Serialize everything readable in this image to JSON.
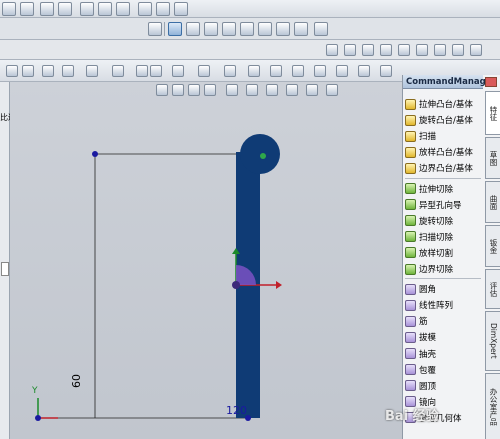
{
  "command_manager": {
    "title": "CommandManager",
    "items": [
      {
        "label": "拉伸凸台/基体",
        "kind": "boss"
      },
      {
        "label": "旋转凸台/基体",
        "kind": "boss"
      },
      {
        "label": "扫描",
        "kind": "boss"
      },
      {
        "label": "放样凸台/基体",
        "kind": "boss"
      },
      {
        "label": "边界凸台/基体",
        "kind": "boss"
      },
      {
        "label": "拉伸切除",
        "kind": "cut"
      },
      {
        "label": "异型孔向导",
        "kind": "cut"
      },
      {
        "label": "旋转切除",
        "kind": "cut"
      },
      {
        "label": "扫描切除",
        "kind": "cut"
      },
      {
        "label": "放样切割",
        "kind": "cut"
      },
      {
        "label": "边界切除",
        "kind": "cut"
      },
      {
        "label": "圆角",
        "kind": "feature"
      },
      {
        "label": "线性阵列",
        "kind": "feature"
      },
      {
        "label": "筋",
        "kind": "feature"
      },
      {
        "label": "拔模",
        "kind": "feature"
      },
      {
        "label": "抽壳",
        "kind": "feature"
      },
      {
        "label": "包覆",
        "kind": "feature"
      },
      {
        "label": "圆顶",
        "kind": "feature"
      },
      {
        "label": "镜向",
        "kind": "feature"
      },
      {
        "label": "参考几何体",
        "kind": "feature"
      }
    ],
    "tabs": [
      "特征",
      "草图",
      "曲面",
      "钣金",
      "评估",
      "DimXpert",
      "办公室产品"
    ]
  },
  "sketch": {
    "dim_vertical": "60",
    "dim_bottom": "120",
    "origin_label": "Y"
  },
  "left_panel_text": "比达",
  "watermark": "Bai 经验",
  "colors": {
    "part_fill": "#0f3b75",
    "sketch_line": "#222222",
    "point": "#1a1aa0",
    "axis_red": "#c0202a",
    "axis_green": "#1b8a2a"
  }
}
